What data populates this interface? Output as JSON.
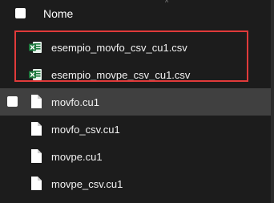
{
  "header": {
    "column_label": "Nome",
    "sort_indicator": "^"
  },
  "rows": [
    {
      "name": "esempio_movfo_csv_cu1.csv",
      "icon": "excel-csv-icon",
      "selected": false,
      "highlighted": true
    },
    {
      "name": "esempio_movpe_csv_cu1.csv",
      "icon": "excel-csv-icon",
      "selected": false,
      "highlighted": true
    },
    {
      "name": "movfo.cu1",
      "icon": "file-icon",
      "selected": true,
      "highlighted": false
    },
    {
      "name": "movfo_csv.cu1",
      "icon": "file-icon",
      "selected": false,
      "highlighted": false
    },
    {
      "name": "movpe.cu1",
      "icon": "file-icon",
      "selected": false,
      "highlighted": false
    },
    {
      "name": "movpe_csv.cu1",
      "icon": "file-icon",
      "selected": false,
      "highlighted": false
    }
  ],
  "colors": {
    "background": "#1c1c1c",
    "selected_row": "#404040",
    "highlight_border": "#e03a3a",
    "excel_green": "#1d7a3e"
  }
}
